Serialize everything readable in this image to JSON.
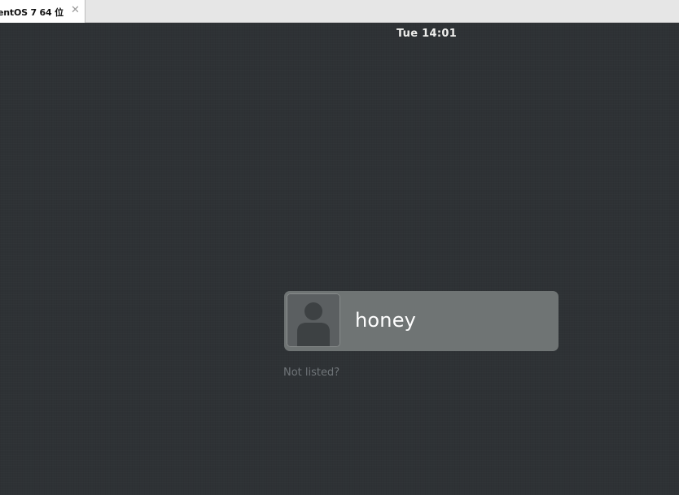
{
  "vm_tab": {
    "title": "entOS 7 64 位",
    "close_glyph": "✕"
  },
  "top_bar": {
    "clock": "Tue 14:01"
  },
  "login": {
    "user_name": "honey",
    "not_listed": "Not listed?"
  },
  "icons": {
    "avatar": "user-avatar-icon",
    "close": "close-icon"
  },
  "colors": {
    "background": "#2e3235",
    "card": "#6f7474",
    "text_primary": "#ffffff",
    "text_muted": "#6f7478"
  }
}
